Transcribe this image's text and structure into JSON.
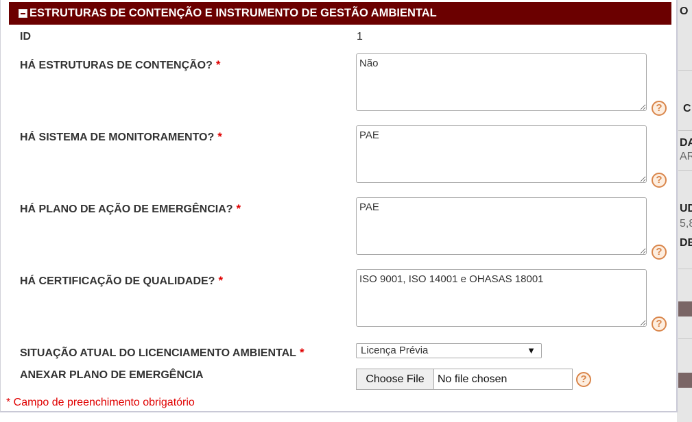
{
  "section": {
    "title": "ESTRUTURAS DE CONTENÇÃO E INSTRUMENTO DE GESTÃO AMBIENTAL"
  },
  "fields": {
    "id": {
      "label": "ID",
      "value": "1"
    },
    "estruturas": {
      "label": "HÁ ESTRUTURAS DE CONTENÇÃO?",
      "value": "Não"
    },
    "monitoramento": {
      "label": "HÁ SISTEMA DE MONITORAMENTO?",
      "value": "PAE"
    },
    "plano_acao": {
      "label": "HÁ PLANO DE AÇÃO DE EMERGÊNCIA?",
      "value": "PAE"
    },
    "certificacao": {
      "label": "HÁ CERTIFICAÇÃO DE QUALIDADE?",
      "value": "ISO 9001, ISO 14001 e OHASAS 18001"
    },
    "licenciamento": {
      "label": "SITUAÇÃO ATUAL DO LICENCIAMENTO AMBIENTAL",
      "selected": "Licença Prévia"
    },
    "anexo": {
      "label": "ANEXAR PLANO DE EMERGÊNCIA",
      "button": "Choose File",
      "status": "No file chosen"
    }
  },
  "required_marker": "*",
  "help_glyph": "?",
  "select_arrow": "▼",
  "footnote": "* Campo de preenchimento obrigatório",
  "background_strip": {
    "t1": "O",
    "t2": "C",
    "t3": "DA",
    "t4": "AR",
    "t5": "UD",
    "t6": "5,8",
    "t7": "DE"
  },
  "colors": {
    "header_bg": "#6b0000",
    "required": "#e00000",
    "help_icon": "#d9854a"
  }
}
